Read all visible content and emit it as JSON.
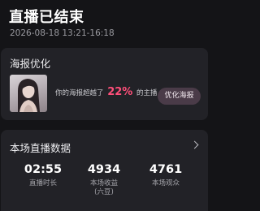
{
  "header": {
    "title": "直播已结束",
    "time_range": "2026-08-18 13:21-16:18"
  },
  "poster_card": {
    "title": "海报优化",
    "text_prefix": "你的海报超越了",
    "percent": "22%",
    "text_suffix": "的主播",
    "button_label": "优化海报"
  },
  "stats_card": {
    "title": "本场直播数据",
    "stats": [
      {
        "value": "02:55",
        "label": "直播时长",
        "sublabel": ""
      },
      {
        "value": "4934",
        "label": "本场收益",
        "sublabel": "(六豆)"
      },
      {
        "value": "4761",
        "label": "本场观众",
        "sublabel": ""
      }
    ]
  },
  "colors": {
    "accent_pink": "#ff4f7a",
    "card_bg": "#222227",
    "page_bg": "#141417"
  }
}
